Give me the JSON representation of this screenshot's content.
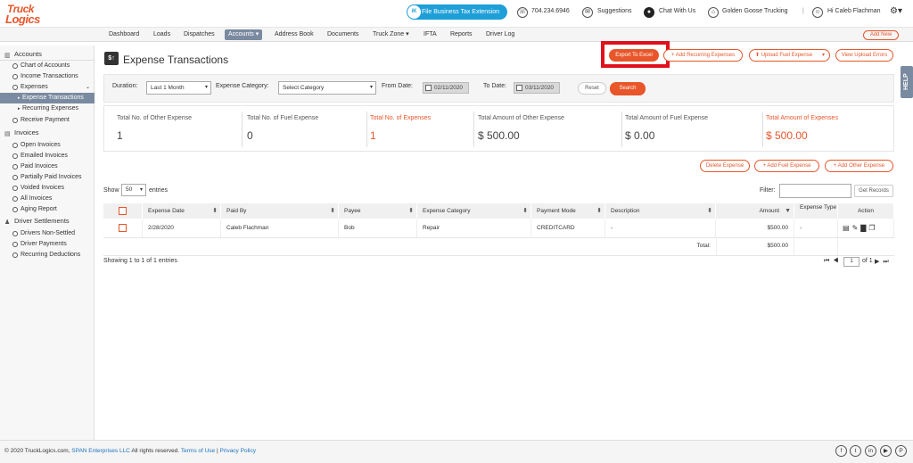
{
  "brand": {
    "logo_line1": "Truck",
    "logo_line2": "Logics"
  },
  "topbar": {
    "file_tax_icon": "iK",
    "file_tax": "File Business Tax Extension",
    "phone": "704.234.6946",
    "suggestions": "Suggestions",
    "chat": "Chat With Us",
    "company": "Golden Goose Trucking",
    "separator": "|",
    "user": "Hi Caleb Flachman"
  },
  "nav": {
    "items": [
      "Dashboard",
      "Loads",
      "Dispatches",
      "Accounts ▾",
      "Address Book",
      "Documents",
      "Truck Zone ▾",
      "IFTA",
      "Reports",
      "Driver Log"
    ],
    "add_new": "Add New"
  },
  "sidebar": {
    "accounts": "Accounts",
    "chart_of_accounts": "Chart of Accounts",
    "income_transactions": "Income Transactions",
    "expenses": "Expenses",
    "expense_transactions": "Expense Transactions",
    "recurring_expenses": "Recurring Expenses",
    "receive_payment": "Receive Payment",
    "invoices": "Invoices",
    "open_invoices": "Open Invoices",
    "emailed_invoices": "Emailed Invoices",
    "paid_invoices": "Paid Invoices",
    "partially_paid": "Partially Paid Invoices",
    "voided_invoices": "Voided Invoices",
    "all_invoices": "All Invoices",
    "aging_report": "Aging Report",
    "driver_settlements": "Driver Settlements",
    "drivers_non_settled": "Drivers Non-Settled",
    "driver_payments": "Driver Payments",
    "recurring_deductions": "Recurring Deductions"
  },
  "page": {
    "title_icon": "$↑",
    "title": "Expense Transactions",
    "export_excel": "Export To Excel",
    "add_recurring": "+ Add Recurring Expenses",
    "upload_fuel": "⬆ Upload Fuel Expense",
    "upload_fuel_caret": "▾",
    "view_upload_errors": "View Upload Errors"
  },
  "filter": {
    "duration_label": "Duration:",
    "duration_value": "Last 1 Month",
    "category_label": "Expense Category:",
    "category_value": "Select Category",
    "from_label": "From Date:",
    "from_value": "02/11/2020",
    "to_label": "To Date:",
    "to_value": "03/11/2020",
    "reset": "Reset",
    "search": "Search",
    "help": "HELP"
  },
  "stats": [
    {
      "label": "Total No. of Other Expense",
      "value": "1"
    },
    {
      "label": "Total No. of Fuel Expense",
      "value": "0"
    },
    {
      "label": "Total No. of Expenses",
      "value": "1"
    },
    {
      "label": "Total Amount of Other Expense",
      "value": "$ 500.00"
    },
    {
      "label": "Total Amount of Fuel Expense",
      "value": "$ 0.00"
    },
    {
      "label": "Total Amount of Expenses",
      "value": "$ 500.00"
    }
  ],
  "actions": {
    "delete_expense": "Delete Expense",
    "add_fuel_expense": "+ Add Fuel Expense",
    "add_other_expense": "+ Add Other Expense"
  },
  "table": {
    "show_label": "Show",
    "show_value": "50",
    "entries_label": "entries",
    "filter_label": "Filter:",
    "filter_value": "",
    "get_records": "Get Records",
    "headers": [
      "Expense Date",
      "Paid By",
      "Payee",
      "Expense Category",
      "Payment Mode",
      "Description",
      "Amount",
      "Expense Type",
      "Action"
    ],
    "rows": [
      {
        "date": "2/28/2020",
        "paid_by": "Caleb Flachman",
        "payee": "Bob",
        "category": "Repair",
        "mode": "CREDITCARD",
        "description": "-",
        "amount": "$500.00",
        "type": "-"
      }
    ],
    "total_label": "Total:",
    "total_value": "$500.00",
    "showing": "Showing 1 to 1 of 1 entries",
    "page_value": "1",
    "page_of": "of 1"
  },
  "footer": {
    "copyright": "© 2020 TruckLogics.com,",
    "company_link": "SPAN Enterprises LLC",
    "rights": "All rights reserved.",
    "terms": "Terms of Use",
    "sep": "|",
    "privacy": "Privacy Policy",
    "social": [
      "f",
      "t",
      "in",
      "▶",
      "P"
    ]
  },
  "colors": {
    "accent": "#e8562a",
    "nav_active": "#7a8aa0",
    "highlight_box": "#e0101c",
    "brand_blue": "#1e9fd8"
  }
}
